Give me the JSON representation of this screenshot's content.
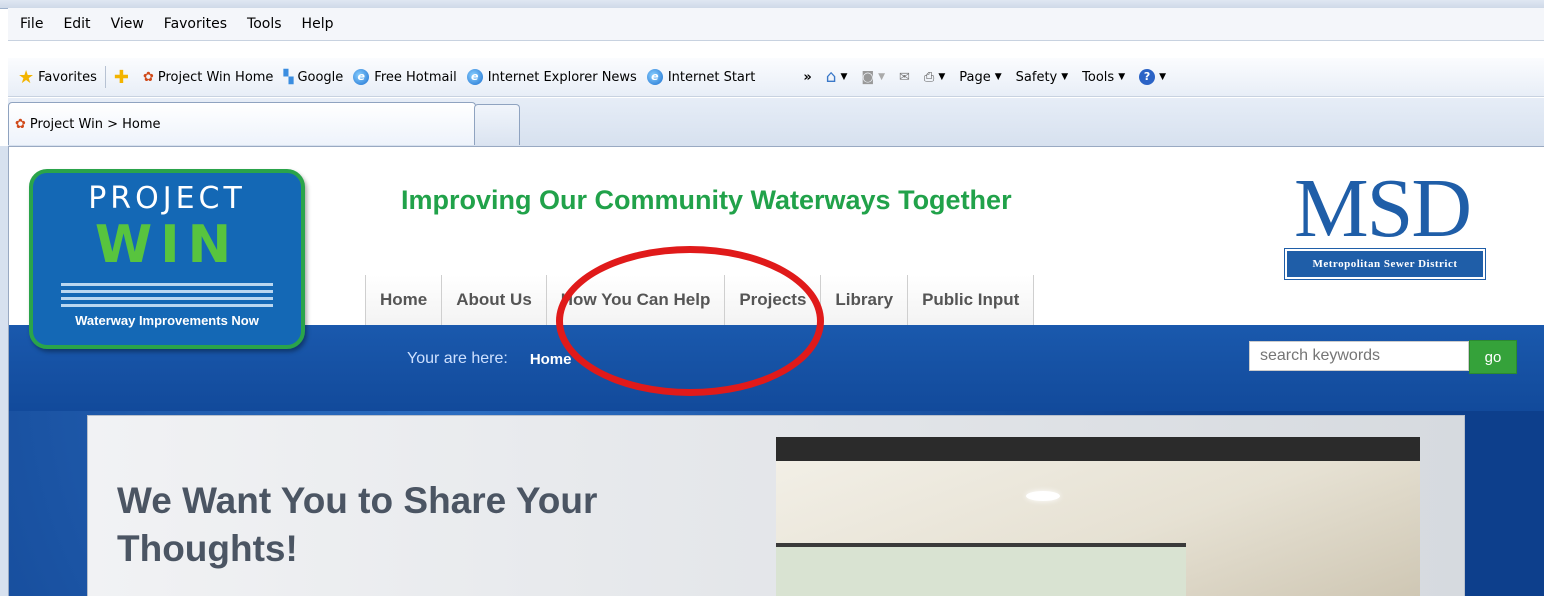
{
  "browser": {
    "menu": [
      "File",
      "Edit",
      "View",
      "Favorites",
      "Tools",
      "Help"
    ],
    "favorites_label": "Favorites",
    "favorites": [
      "Project Win Home",
      "Google",
      "Free Hotmail",
      "Internet Explorer News",
      "Internet Start"
    ],
    "overflow": "»",
    "commands": [
      "Page",
      "Safety",
      "Tools"
    ],
    "tab_title": "Project Win > Home"
  },
  "site": {
    "logo_top": "PROJECT",
    "logo_main": "WIN",
    "logo_tagline": "Waterway Improvements Now",
    "tagline": "Improving Our Community Waterways Together",
    "msd_letters": "MSD",
    "msd_name": "Metropolitan Sewer District",
    "nav": [
      "Home",
      "About Us",
      "How You Can Help",
      "Projects",
      "Library",
      "Public Input"
    ],
    "breadcrumb_label": "Your are here:",
    "breadcrumb_current": "Home",
    "search_placeholder": "search keywords",
    "search_button": "go",
    "content_title": "We Want You to Share Your Thoughts!"
  },
  "colors": {
    "accent_green": "#21a24a",
    "brand_blue": "#1f5ea8",
    "annotation_red": "#e01a1a"
  }
}
